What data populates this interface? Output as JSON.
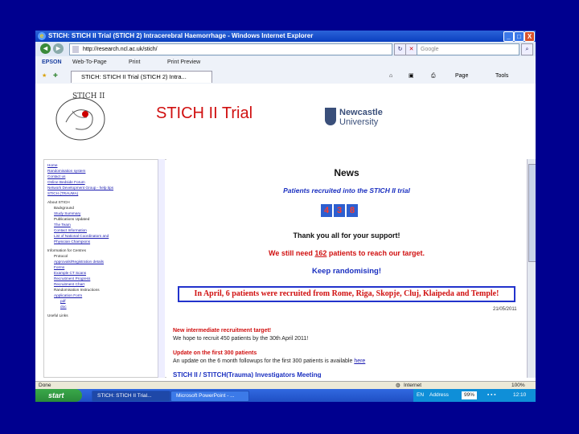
{
  "window": {
    "title": "STICH: STICH II Trial (STICH 2) Intracerebral Haemorrhage - Windows Internet Explorer",
    "controls": {
      "minimize": "_",
      "maximize": "□",
      "close": "X"
    }
  },
  "address_bar": {
    "back": "◄",
    "forward": "►",
    "url": "http://research.ncl.ac.uk/stich/",
    "search_placeholder": "Google"
  },
  "toolbar": {
    "epson": "EPSON",
    "web_to_page": "Web-To-Page",
    "print": "Print",
    "print_preview": "Print Preview"
  },
  "favorites": {
    "tab_label": "STICH: STICH II Trial (STICH 2) Intra...",
    "page_menu": "Page",
    "tools_menu": "Tools"
  },
  "header": {
    "site_title": "STICH II Trial",
    "university_line1": "Newcastle",
    "university_line2": "University"
  },
  "sidebar": {
    "items": [
      {
        "text": "Home",
        "link": true
      },
      {
        "text": "Randomisation system",
        "link": true
      },
      {
        "text": "Contact us",
        "link": true
      },
      {
        "text": "Online Bedside Forum",
        "link": true
      },
      {
        "text": "Network Development Group - help tips",
        "link": true
      },
      {
        "text": "STICH (TRAUMA)",
        "link": true
      },
      {
        "text": "About STICH",
        "link": false
      },
      {
        "text": "Background",
        "link": false
      },
      {
        "text": "Study Summary",
        "link": true
      },
      {
        "text": "Publications Updated",
        "link": false
      },
      {
        "text": "The Team",
        "link": true
      },
      {
        "text": "Contact Information",
        "link": true
      },
      {
        "text": "List of National Coordinators and",
        "link": true
      },
      {
        "text": "Physician Champions",
        "link": true
      },
      {
        "text": "Information for Centres",
        "link": false
      },
      {
        "text": "Protocol",
        "link": false
      },
      {
        "text": "Approvals/Registration details",
        "link": true
      },
      {
        "text": "Forms",
        "link": true
      },
      {
        "text": "Example CT Scans",
        "link": true
      },
      {
        "text": "Recruitment Progress",
        "link": true
      },
      {
        "text": "Recruitment Chart",
        "link": true
      },
      {
        "text": "Randomisation Instructions",
        "link": false
      },
      {
        "text": "Application Form",
        "link": true
      },
      {
        "text": "pdf",
        "link": true
      },
      {
        "text": "doc",
        "link": true
      },
      {
        "text": "Useful Links",
        "link": false
      }
    ]
  },
  "news": {
    "heading": "News",
    "recruited_label": "Patients recruited into the STICH II trial",
    "digits": [
      "4",
      "3",
      "8"
    ],
    "thanks": "Thank you all for your support!",
    "need_prefix": "We still need ",
    "need_number": "162",
    "need_suffix": " patients to reach our target.",
    "keep": "Keep randomising!",
    "april": "In April, 6 patients were recruited from Rome, Riga, Skopje, Cluj, Klaipeda and Temple!",
    "date": "21/05/2011",
    "target_heading": "New intermediate recruitment target!",
    "target_text": "We hope to recruit 450 patients by the 30th April 2011!",
    "update_heading": "Update on the first 300 patients",
    "update_text_prefix": "An update on the 6 month followups for the first 300 patients is available ",
    "update_link": "here",
    "meeting_heading": "STICH II / STITCH(Trauma) Investigators Meeting"
  },
  "status_bar": {
    "done": "Done",
    "zone": "Internet",
    "zoom": "100%"
  },
  "taskbar": {
    "start": "start",
    "tasks": [
      "STICH: STICH II Trial...",
      "Microsoft PowerPoint - ..."
    ],
    "tray_lang": "EN",
    "tray_address": "Address",
    "tray_zoom": "99%",
    "clock": "12:10"
  },
  "colors": {
    "background": "#00008f",
    "title_red": "#d01010",
    "link_blue": "#1a1ab0",
    "digit_blue": "#2d5fd0"
  }
}
